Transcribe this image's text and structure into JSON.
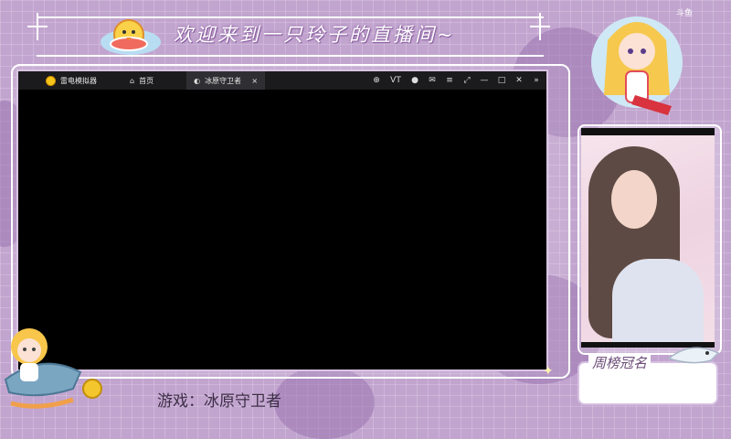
{
  "overlay": {
    "title": "欢迎来到一只玲子的直播间~",
    "name_tag": "周榜冠名",
    "game_label": "游戏：冰原守卫者",
    "watermark": "斗鱼"
  },
  "emulator": {
    "tabs": [
      {
        "label": "雷电模拟器",
        "icon": "leidian-logo-icon"
      },
      {
        "label": "首页",
        "icon": "home-icon"
      },
      {
        "label": "冰原守卫者",
        "icon": "game-icon",
        "active": true
      }
    ],
    "close_glyph": "×",
    "controls": [
      "gamepad-icon",
      "vt-icon",
      "user-icon",
      "mail-icon",
      "menu-icon",
      "fullscreen-icon",
      "minimize-icon",
      "maximize-icon",
      "close-icon",
      "collapse-icon"
    ],
    "control_glyphs": {
      "gamepad": "⊕",
      "vt": "VT",
      "user": "●",
      "mail": "✉",
      "menu": "≡",
      "fullscreen": "⤢",
      "minimize": "—",
      "maximize": "□",
      "close": "✕",
      "collapse": "»"
    }
  },
  "colors": {
    "background": "#c2a5cf",
    "frame": "#ffffff",
    "accent": "#6a4b76"
  }
}
